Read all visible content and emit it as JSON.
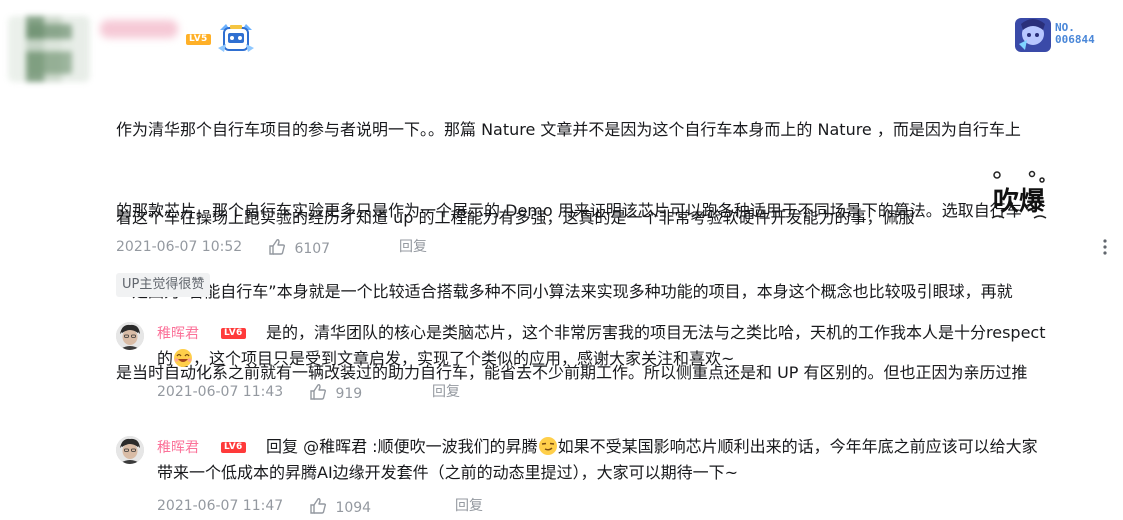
{
  "main_comment": {
    "user_level": "LV5",
    "fan_card_label": "NO.",
    "fan_card_number": "006844",
    "text_lines": [
      "作为清华那个自行车项目的参与者说明一下。。那篇 Nature 文章并不是因为这个自行车本身而上的 Nature ，而是因为自行车上",
      "的那款芯片。那个自行车实验更多只是作为一个展示的 Demo 用来证明该芯片可以跑各种适用于不同场景下的算法。选取自行车",
      "一是因为“智能自行车”本身就是一个比较适合搭载多种不同小算法来实现多种功能的项目，本身这个概念也比较吸引眼球，再就",
      "是当时自动化系之前就有一辆改装过的助力自行车，能省去不少前期工作。所以侧重点还是和 UP 有区别的。但也正因为亲历过推",
      "着这个车在操场上跑实验的经历才知道 up 的工程能力有多强，这真的是一个非常考验软硬件开发能力的事，佩服"
    ],
    "sticker_text": "吹爆",
    "timestamp": "2021-06-07 10:52",
    "likes": "6107",
    "reply_label": "回复",
    "up_tag": "UP主觉得很赞"
  },
  "replies": [
    {
      "username": "稚晖君",
      "level": "LV6",
      "text_line1": "是的，清华团队的核心是类脑芯片，这个非常厉害我的项目无法与之类比哈，天机的工作我本人是十分respect",
      "text_line2_a": "的",
      "text_line2_b": "，这个项目只是受到文章启发，实现了个类似的应用，感谢大家关注和喜欢~",
      "timestamp": "2021-06-07 11:43",
      "likes": "919",
      "reply_label": "回复"
    },
    {
      "username": "稚晖君",
      "level": "LV6",
      "text_line1_a": "回复 @稚晖君 :顺便吹一波我们的昇腾",
      "text_line1_b": "如果不受某国影响芯片顺利出来的话，今年年底之前应该可以给大家",
      "text_line2": "带来一个低成本的昇腾AI边缘开发套件（之前的动态里提过），大家可以期待一下~",
      "timestamp": "2021-06-07 11:47",
      "likes": "1094",
      "reply_label": "回复"
    }
  ],
  "colors": {
    "username_pink": "#fb7299",
    "meta_gray": "#9499a0",
    "lv5": "#ffb027",
    "lv6": "#ff3a3a"
  },
  "icons": [
    "thumbs-up-icon",
    "more-vertical-icon",
    "mascot-icon",
    "fan-card-icon",
    "laugh-emoji-icon",
    "smirk-emoji-icon"
  ]
}
